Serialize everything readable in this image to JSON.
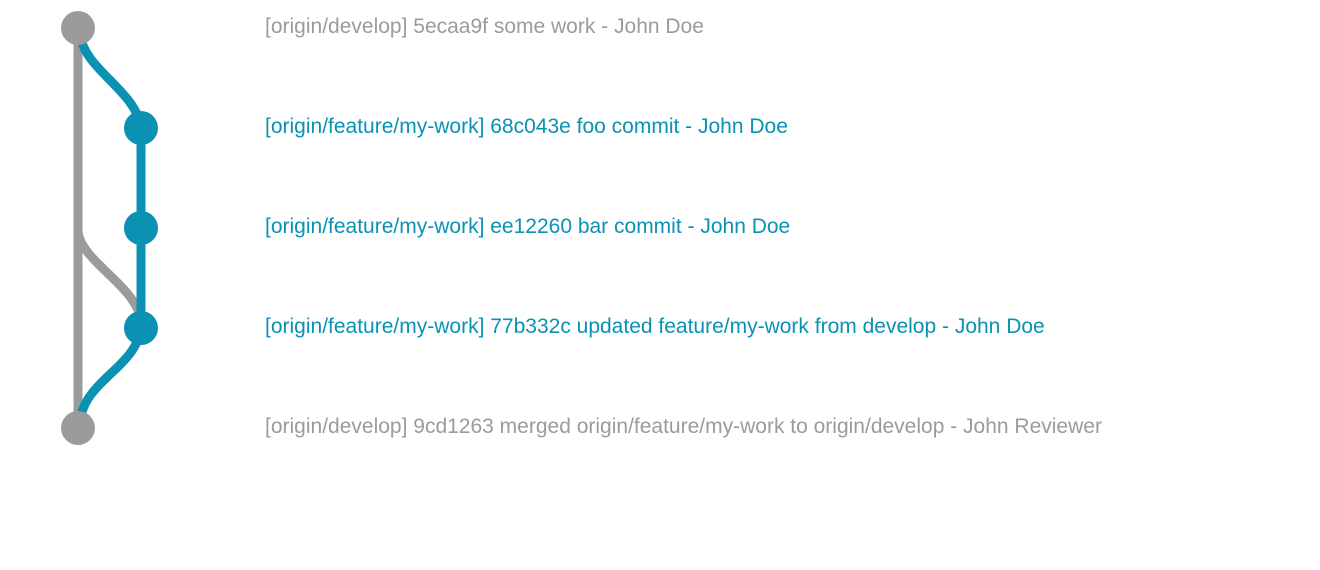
{
  "colors": {
    "develop": "#9b9b9b",
    "feature": "#0a91b4",
    "background": "#ffffff"
  },
  "commits": [
    {
      "branch": "develop",
      "label": "[origin/develop] 5ecaa9f some work - John Doe"
    },
    {
      "branch": "feature",
      "label": "[origin/feature/my-work] 68c043e foo commit - John Doe"
    },
    {
      "branch": "feature",
      "label": "[origin/feature/my-work] ee12260 bar commit - John Doe"
    },
    {
      "branch": "feature",
      "label": "[origin/feature/my-work] 77b332c updated feature/my-work from develop - John Doe"
    },
    {
      "branch": "develop",
      "label": "[origin/develop] 9cd1263 merged origin/feature/my-work to origin/develop - John Reviewer"
    }
  ]
}
